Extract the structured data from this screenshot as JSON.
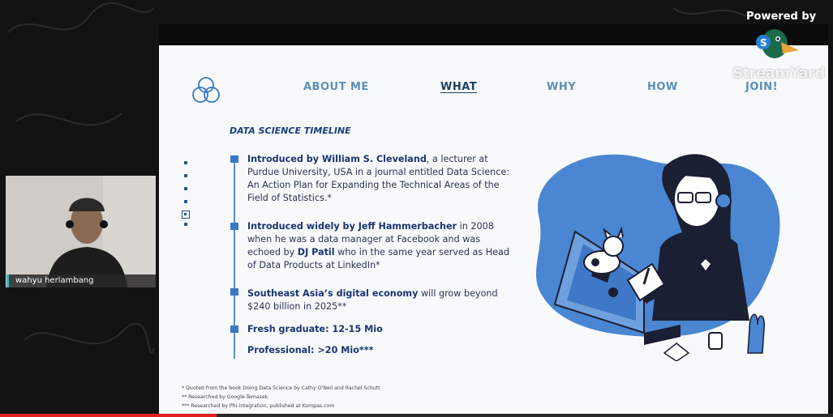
{
  "overlay": {
    "powered_by": "Powered by",
    "brand": "StreamYard"
  },
  "webcam": {
    "name": "wahyu herlambang"
  },
  "slide": {
    "nav": {
      "about": "ABOUT ME",
      "what": "WHAT",
      "why": "WHY",
      "how": "HOW",
      "join": "JOIN!"
    },
    "section_title": "DATA SCIENCE TIMELINE",
    "timeline": [
      {
        "bold": "Introduced by William S. Cleveland",
        "text": ", a lecturer at Purdue University, USA in a journal entitled Data Science: An Action Plan for Expanding the Technical Areas of the Field of Statistics.*"
      },
      {
        "bold": "Introduced widely by Jeff Hammerbacher",
        "text": " in 2008 when he was a data manager at Facebook and was echoed by ",
        "bold2": "DJ Patil",
        "text2": " who in the same year served as Head of Data Products at LinkedIn*"
      },
      {
        "bold": "Southeast Asia’s digital economy",
        "text": " will grow beyond $240 billion in 2025**"
      },
      {
        "bold": "Fresh graduate: 12-15 Mio",
        "text": ""
      },
      {
        "bold": "Professional: >20 Mio***",
        "text": ""
      }
    ],
    "footnotes": [
      "* Quoted from the book Doing Data Science by Cathy O'Neil and Rachel Schutt",
      "** Researched by Google-Temasek",
      "*** Researched by Phi-integration, published at Kompas.com"
    ],
    "illustration_icon": "woman-with-laptop-and-cat-illustration",
    "logo_icon": "venn-circles-logo-icon"
  },
  "video": {
    "progress": 0.26
  },
  "colors": {
    "accent": "#3a78c4",
    "nav": "#5b8fb8",
    "nav_active": "#1e3f5e",
    "blob": "#4a86d2"
  }
}
